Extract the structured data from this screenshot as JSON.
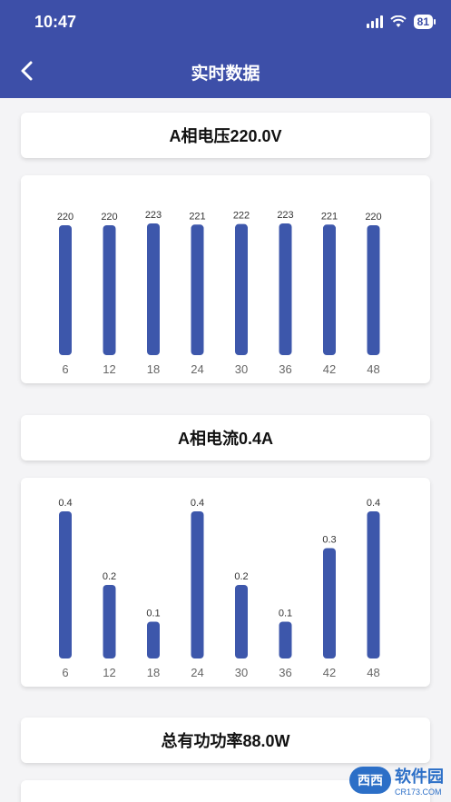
{
  "status_bar": {
    "time": "10:47",
    "battery": "81"
  },
  "header": {
    "title": "实时数据"
  },
  "sections": [
    {
      "title": "A相电压220.0V"
    },
    {
      "title": "A相电流0.4A"
    },
    {
      "title": "总有功功率88.0W"
    }
  ],
  "chart_data": [
    {
      "type": "bar",
      "title": "",
      "categories": [
        "6",
        "12",
        "18",
        "24",
        "30",
        "36",
        "42",
        "48"
      ],
      "values": [
        220,
        220,
        223,
        221,
        222,
        223,
        221,
        220
      ],
      "value_labels": [
        "220",
        "220",
        "223",
        "221",
        "222",
        "223",
        "221",
        "220"
      ],
      "color": "#3d57ab"
    },
    {
      "type": "bar",
      "title": "",
      "categories": [
        "6",
        "12",
        "18",
        "24",
        "30",
        "36",
        "42",
        "48"
      ],
      "values": [
        0.4,
        0.2,
        0.1,
        0.4,
        0.2,
        0.1,
        0.3,
        0.4
      ],
      "value_labels": [
        "0.4",
        "0.2",
        "0.1",
        "0.4",
        "0.2",
        "0.1",
        "0.3",
        "0.4"
      ],
      "color": "#3d57ab"
    }
  ],
  "watermark": {
    "logo": "西西",
    "text": "软件园",
    "sub": "CR173.COM"
  },
  "colors": {
    "primary": "#3d4fa8",
    "bar": "#3d57ab",
    "background": "#f4f4f6"
  }
}
